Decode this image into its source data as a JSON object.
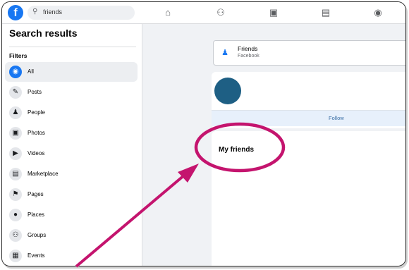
{
  "topbar": {
    "logo_letter": "f",
    "search_value": "friends",
    "nav_icons": [
      "home-icon",
      "friends-icon",
      "watch-icon",
      "marketplace-icon",
      "gaming-icon"
    ]
  },
  "sidebar": {
    "title": "Search results",
    "filters_label": "Filters",
    "items": [
      {
        "label": "All",
        "icon": "all-filter-icon",
        "active": true
      },
      {
        "label": "Posts",
        "icon": "posts-icon",
        "active": false
      },
      {
        "label": "People",
        "icon": "people-icon",
        "active": false
      },
      {
        "label": "Photos",
        "icon": "photos-icon",
        "active": false
      },
      {
        "label": "Videos",
        "icon": "videos-icon",
        "active": false
      },
      {
        "label": "Marketplace",
        "icon": "marketplace-icon",
        "active": false
      },
      {
        "label": "Pages",
        "icon": "pages-flag-icon",
        "active": false
      },
      {
        "label": "Places",
        "icon": "places-pin-icon",
        "active": false
      },
      {
        "label": "Groups",
        "icon": "groups-icon",
        "active": false
      },
      {
        "label": "Events",
        "icon": "events-icon",
        "active": false
      }
    ]
  },
  "main": {
    "friends_card": {
      "title": "Friends",
      "subtitle": "Facebook"
    },
    "profile_card": {
      "follow_label": "Follow"
    },
    "friends_section": {
      "title": "My friends"
    }
  },
  "colors": {
    "brand": "#1877f2",
    "annotation": "#c4146e"
  }
}
